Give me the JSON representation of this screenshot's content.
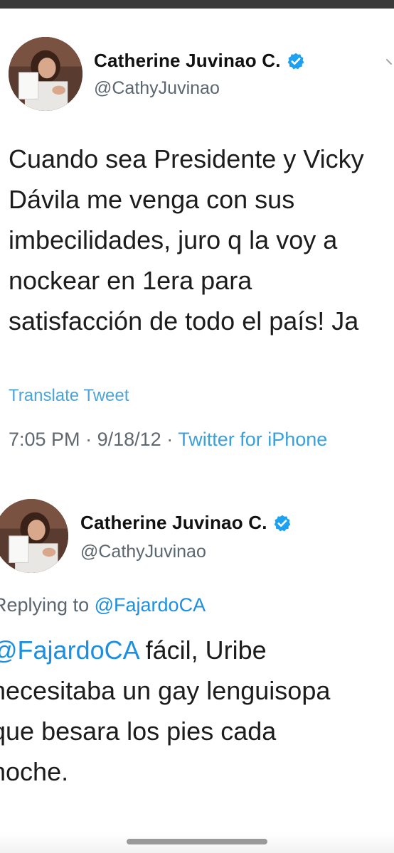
{
  "tweets": [
    {
      "display_name": "Catherine Juvinao C.",
      "handle": "@CathyJuvinao",
      "text": "Cuando sea Presidente y Vicky\nDávila me venga con sus\nimbecilidades, juro q la voy a\nnockear en 1era para\nsatisfacción de todo el país! Ja",
      "translate_label": "Translate Tweet",
      "time": "7:05 PM",
      "date": "9/18/12",
      "source": "Twitter for iPhone"
    },
    {
      "display_name": "Catherine Juvinao C.",
      "handle": "@CathyJuvinao",
      "replying_prefix": "Replying to",
      "replying_to": "@FajardoCA",
      "text_mention": "@FajardoCA",
      "text_rest": " fácil, Uribe\nnecesitaba un gay lenguisopa\nque besara los pies cada\nnoche."
    }
  ],
  "icons": {
    "verified": "verified-badge-icon",
    "more": "chevron-down-icon"
  },
  "colors": {
    "link_blue": "#1d8fe0",
    "verified_blue": "#1da1f2",
    "secondary_text": "#5b6670"
  }
}
